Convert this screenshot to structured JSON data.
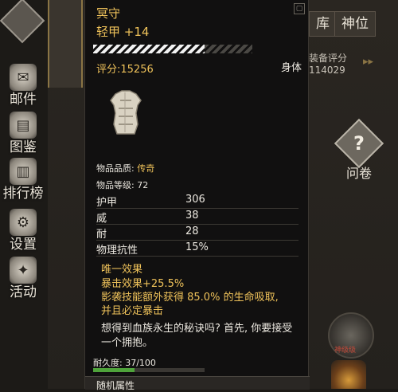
{
  "background": {
    "sidebar": [
      {
        "label": "邮件",
        "icon": "envelope-icon"
      },
      {
        "label": "图鉴",
        "icon": "book-icon"
      },
      {
        "label": "排行榜",
        "icon": "ranking-icon"
      },
      {
        "label": "设置",
        "icon": "gear-icon"
      },
      {
        "label": "活动",
        "icon": "event-icon"
      }
    ],
    "tabs": [
      "库",
      "神位"
    ],
    "score_label": "装备评分",
    "score_value": "114029",
    "help_label": "问卷",
    "boss_label": "神级级"
  },
  "tooltip": {
    "name": "冥守",
    "subtitle": "轻甲 +14",
    "rating": "评分:15256",
    "slot": "身体",
    "quality_label": "物品品质:",
    "quality_value": "传奇",
    "level_line": "物品等级: 72",
    "stats": [
      {
        "label": "护甲",
        "value": "306"
      },
      {
        "label": "威",
        "value": "38"
      },
      {
        "label": "耐",
        "value": "28"
      },
      {
        "label": "物理抗性",
        "value": "15%"
      }
    ],
    "unique_title": "唯一效果",
    "unique_effects": [
      "暴击效果+25.5%",
      "影袭技能额外获得 85.0% 的生命吸取,",
      "并且必定暴击"
    ],
    "lore": "想得到血族永生的秘诀吗? 首先, 你要接受一个拥抱。",
    "durability_text": "耐久度: 37/100",
    "durability_ratio": 0.37,
    "random_attrs_header": "随机属性"
  },
  "colors": {
    "gold": "#efc25a",
    "durability_green": "#4fa33b"
  }
}
